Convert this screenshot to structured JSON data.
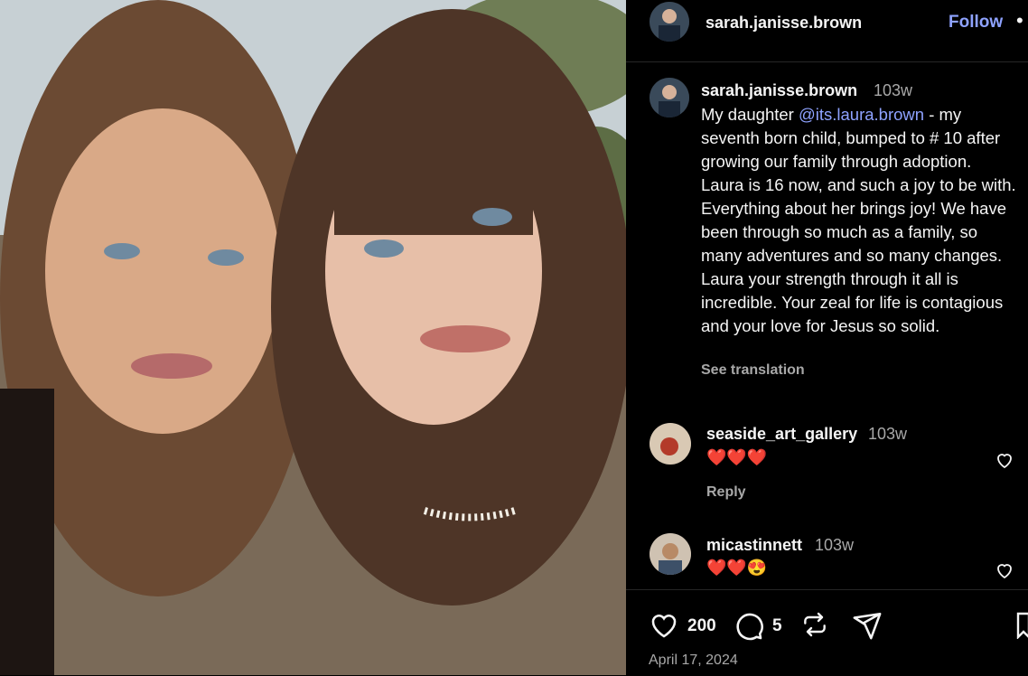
{
  "header": {
    "username": "sarah.janisse.brown",
    "follow_label": "Follow",
    "more_label": "•"
  },
  "post": {
    "username": "sarah.janisse.brown",
    "time": "103w",
    "caption_pre": "My daughter ",
    "mention": "@its.laura.brown",
    "caption_post": " - my seventh born child, bumped to # 10 after growing our family through adoption. Laura is 16 now, and such a joy to be with. Everything about her brings joy! We have been through so much as a family, so many adventures and so many changes. Laura your strength through it all is incredible. Your zeal for life is contagious and your love for Jesus so solid.",
    "see_translation": "See translation"
  },
  "comments": [
    {
      "username": "seaside_art_gallery",
      "time": "103w",
      "text": "❤️❤️❤️",
      "reply": "Reply"
    },
    {
      "username": "micastinnett",
      "time": "103w",
      "text": "❤️❤️😍"
    }
  ],
  "actions": {
    "likes": "200",
    "comments": "5"
  },
  "date": "April 17, 2024",
  "colors": {
    "accent": "#8ea2ff",
    "muted": "#a8a8a8",
    "bg": "#000000"
  }
}
